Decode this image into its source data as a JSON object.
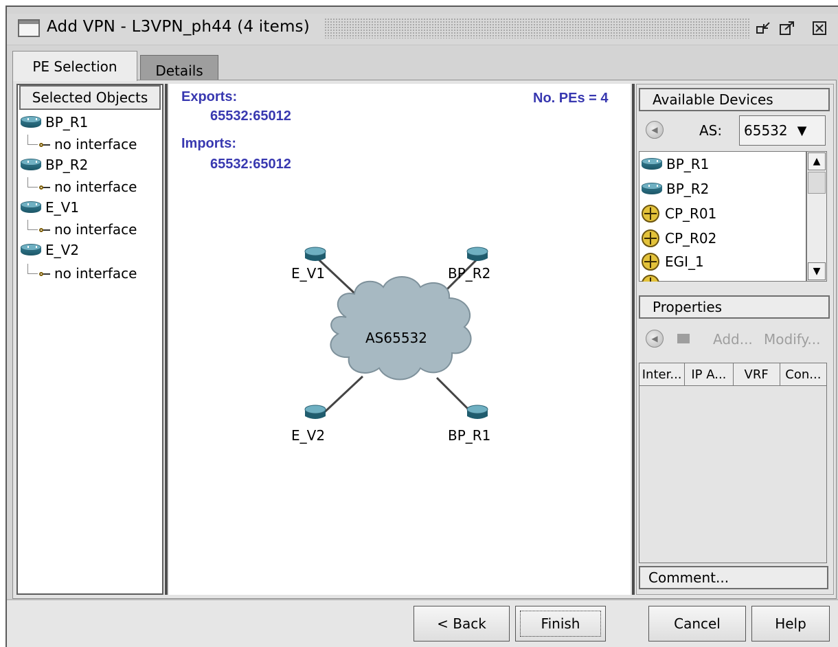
{
  "window": {
    "title": "Add VPN - L3VPN_ph44 (4 items)",
    "controls": [
      "restore-icon",
      "maximize-icon",
      "close-icon"
    ]
  },
  "tabs": [
    {
      "label": "PE Selection",
      "active": true
    },
    {
      "label": "Details",
      "active": false
    }
  ],
  "selected_objects": {
    "header": "Selected Objects",
    "items": [
      {
        "name": "BP_R1",
        "interface": "no interface"
      },
      {
        "name": "BP_R2",
        "interface": "no interface"
      },
      {
        "name": "E_V1",
        "interface": "no interface"
      },
      {
        "name": "E_V2",
        "interface": "no interface"
      }
    ]
  },
  "topology": {
    "exports_label": "Exports:",
    "exports_value": "65532:65012",
    "imports_label": "Imports:",
    "imports_value": "65532:65012",
    "pe_count": "No. PEs = 4",
    "cloud_label": "AS65532",
    "nodes": [
      "E_V1",
      "BP_R2",
      "E_V2",
      "BP_R1"
    ]
  },
  "available_devices": {
    "header": "Available Devices",
    "as_label": "AS:",
    "as_value": "65532",
    "devices": [
      {
        "name": "BP_R1",
        "icon": "router-icon"
      },
      {
        "name": "BP_R2",
        "icon": "router-icon"
      },
      {
        "name": "CP_R01",
        "icon": "juniper-router-icon"
      },
      {
        "name": "CP_R02",
        "icon": "juniper-router-icon"
      },
      {
        "name": "EGI_1",
        "icon": "juniper-router-icon"
      }
    ]
  },
  "properties": {
    "header": "Properties",
    "add_label": "Add...",
    "modify_label": "Modify...",
    "columns": [
      "Inter...",
      "IP A...",
      "VRF",
      "Con..."
    ]
  },
  "comment_label": "Comment...",
  "buttons": {
    "back": "< Back",
    "finish": "Finish",
    "cancel": "Cancel",
    "help": "Help"
  }
}
